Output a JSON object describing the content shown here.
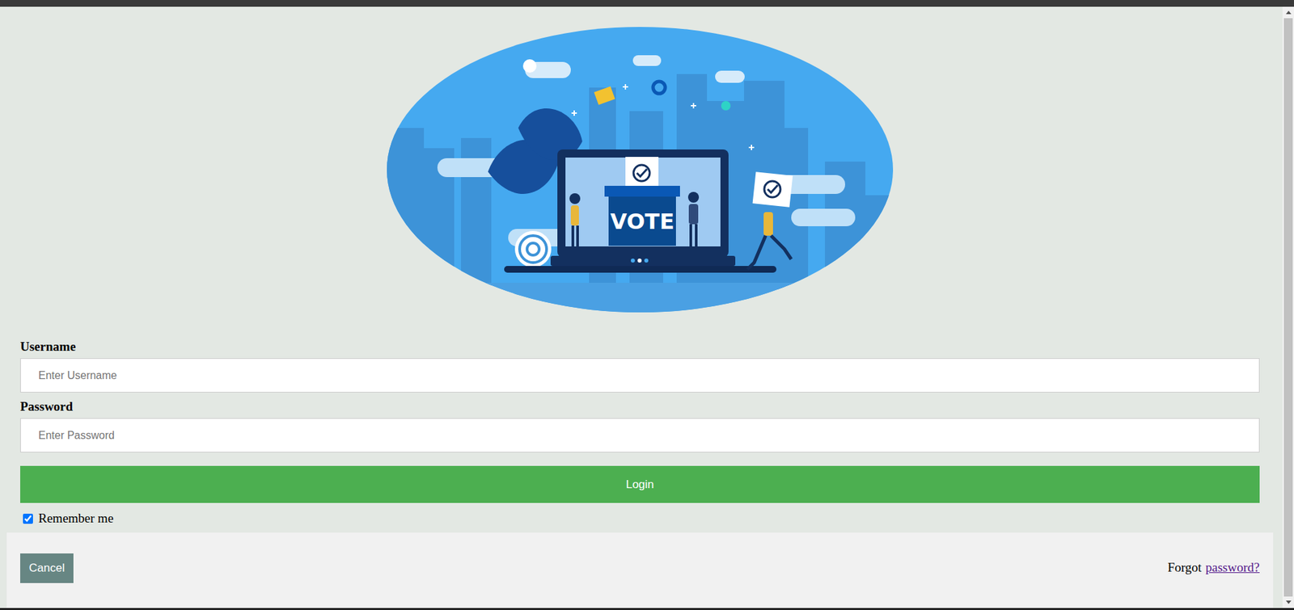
{
  "illustration": {
    "label": "VOTE"
  },
  "form": {
    "username": {
      "label": "Username",
      "placeholder": "Enter Username"
    },
    "password": {
      "label": "Password",
      "placeholder": "Enter Password"
    },
    "login_button": "Login",
    "remember_me": {
      "label": "Remember me",
      "checked": true
    }
  },
  "footer": {
    "cancel_button": "Cancel",
    "forgot_text": "Forgot",
    "forgot_link": "password?"
  }
}
